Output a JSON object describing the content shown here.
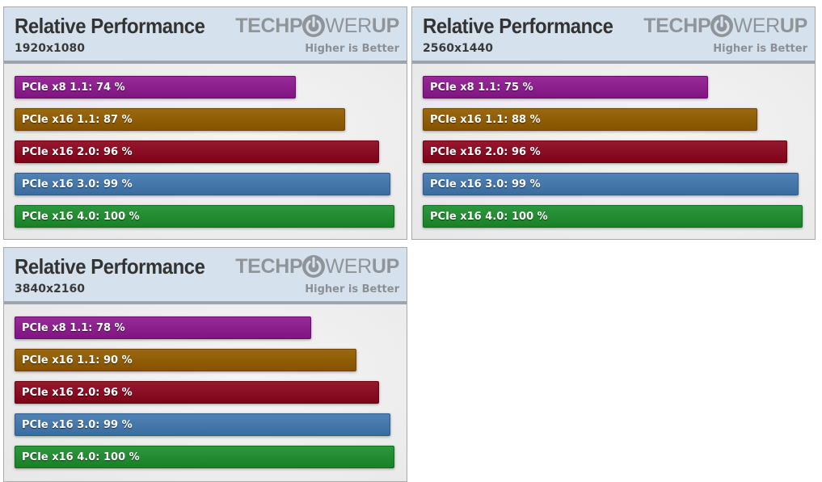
{
  "brand": {
    "logo_left": "TECHP",
    "logo_right": "WER",
    "logo_end": "UP",
    "tagline": "Higher is Better"
  },
  "colors": {
    "PCIe x8 1.1": "#8a1f8c",
    "PCIe x16 1.1": "#8f5c06",
    "PCIe x16 2.0": "#880c22",
    "PCIe x16 3.0": "#4476a9",
    "PCIe x16 4.0": "#228a30",
    "header_bg": "#d6e1ee"
  },
  "chart_data": [
    {
      "type": "bar",
      "orientation": "horizontal",
      "title": "Relative Performance",
      "subtitle": "1920x1080",
      "note": "Higher is Better",
      "categories": [
        "PCIe x8 1.1",
        "PCIe x16 1.1",
        "PCIe x16 2.0",
        "PCIe x16 3.0",
        "PCIe x16 4.0"
      ],
      "values": [
        74,
        87,
        96,
        99,
        100
      ],
      "labels": [
        "PCIe x8 1.1: 74 %",
        "PCIe x16 1.1: 87 %",
        "PCIe x16 2.0: 96 %",
        "PCIe x16 3.0: 99 %",
        "PCIe x16 4.0: 100 %"
      ],
      "unit": "%",
      "xlim": [
        0,
        100
      ],
      "grid": false
    },
    {
      "type": "bar",
      "orientation": "horizontal",
      "title": "Relative Performance",
      "subtitle": "2560x1440",
      "note": "Higher is Better",
      "categories": [
        "PCIe x8 1.1",
        "PCIe x16 1.1",
        "PCIe x16 2.0",
        "PCIe x16 3.0",
        "PCIe x16 4.0"
      ],
      "values": [
        75,
        88,
        96,
        99,
        100
      ],
      "labels": [
        "PCIe x8 1.1: 75 %",
        "PCIe x16 1.1: 88 %",
        "PCIe x16 2.0: 96 %",
        "PCIe x16 3.0: 99 %",
        "PCIe x16 4.0: 100 %"
      ],
      "unit": "%",
      "xlim": [
        0,
        100
      ],
      "grid": false
    },
    {
      "type": "bar",
      "orientation": "horizontal",
      "title": "Relative Performance",
      "subtitle": "3840x2160",
      "note": "Higher is Better",
      "categories": [
        "PCIe x8 1.1",
        "PCIe x16 1.1",
        "PCIe x16 2.0",
        "PCIe x16 3.0",
        "PCIe x16 4.0"
      ],
      "values": [
        78,
        90,
        96,
        99,
        100
      ],
      "labels": [
        "PCIe x8 1.1: 78 %",
        "PCIe x16 1.1: 90 %",
        "PCIe x16 2.0: 96 %",
        "PCIe x16 3.0: 99 %",
        "PCIe x16 4.0: 100 %"
      ],
      "unit": "%",
      "xlim": [
        0,
        100
      ],
      "grid": false
    }
  ]
}
